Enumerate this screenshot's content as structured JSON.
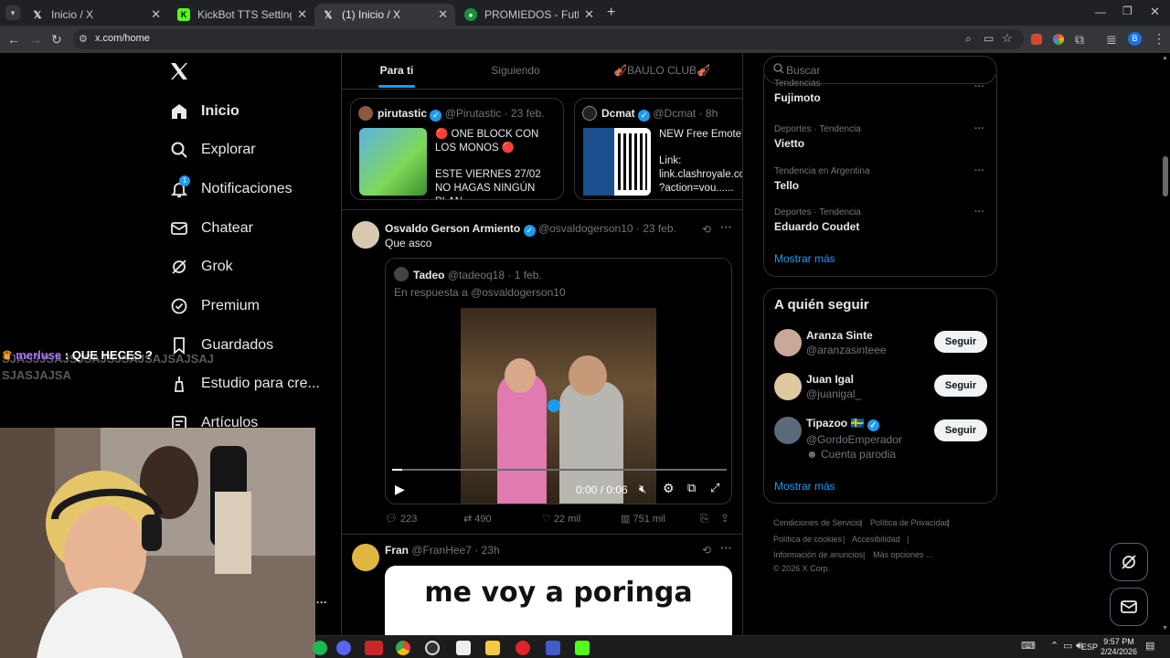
{
  "browser": {
    "tabs": [
      {
        "title": "Inicio / X",
        "active": false
      },
      {
        "title": "KickBot TTS Settings",
        "active": false
      },
      {
        "title": "(1) Inicio / X",
        "active": true
      },
      {
        "title": "PROMIEDOS - Futbol Argentino",
        "active": false
      }
    ],
    "url": "x.com/home"
  },
  "nav": {
    "items": [
      {
        "label": "Inicio",
        "icon": "home-icon"
      },
      {
        "label": "Explorar",
        "icon": "search-icon"
      },
      {
        "label": "Notificaciones",
        "icon": "bell-icon",
        "badge": "1"
      },
      {
        "label": "Chatear",
        "icon": "mail-icon"
      },
      {
        "label": "Grok",
        "icon": "grok-icon"
      },
      {
        "label": "Premium",
        "icon": "premium-icon"
      },
      {
        "label": "Guardados",
        "icon": "bookmark-icon"
      },
      {
        "label": "Estudio para cre...",
        "icon": "creator-studio-icon"
      },
      {
        "label": "Artículos",
        "icon": "articles-icon"
      }
    ]
  },
  "overlay_chat": {
    "username": "merluse",
    "message": ": QUE HECES ?",
    "ghost_line1": "SJASJJSAJSJSAJSJSAJSAJSAJSAJ",
    "ghost_line2": "SJASJAJSA"
  },
  "feed": {
    "tabs": [
      {
        "label": "Para ti",
        "active": true
      },
      {
        "label": "Siguiendo",
        "active": false
      },
      {
        "label": "🎻BAULO CLUB🎻",
        "active": false
      }
    ],
    "carousel": [
      {
        "name": "pirutastic",
        "handle": "@Pirutastic",
        "date": "23 feb.",
        "text1": "🔴 ONE BLOCK CON LOS MONOS 🔴",
        "text2": "ESTE VIERNES 27/02 NO HAGAS NINGÚN PLAN...."
      },
      {
        "name": "Dcmat",
        "handle": "@Dcmat",
        "date": "8h",
        "text1": "NEW Free Emote 😱",
        "text2": "Link: link.clashroyale.com ?action=vou......"
      }
    ],
    "post1": {
      "name": "Osvaldo Gerson Armiento",
      "handle": "@osvaldogerson10",
      "date": "23 feb.",
      "text": "Que asco",
      "quote": {
        "name": "Tadeo",
        "handle": "@tadeoq18",
        "date": "1 feb.",
        "reply_to": "En respuesta a @osvaldogerson10",
        "video_time": "0:00 / 0:06",
        "video_progress": 0.03
      },
      "stats": {
        "replies": "223",
        "reposts": "490",
        "likes": "22 mil",
        "views": "751 mil"
      }
    },
    "post2": {
      "name": "Fran",
      "handle": "@FranHee7",
      "date": "23h",
      "image_text": "me voy a poringa"
    }
  },
  "sidebar": {
    "search_placeholder": "Buscar",
    "trends_partial_cat": "Tendencias",
    "trends": [
      {
        "category": "",
        "name": "Fujimoto"
      },
      {
        "category": "Deportes · Tendencia",
        "name": "Vietto"
      },
      {
        "category": "Tendencia en Argentina",
        "name": "Tello"
      },
      {
        "category": "Deportes · Tendencia",
        "name": "Eduardo Coudet"
      }
    ],
    "show_more": "Mostrar más",
    "who_to_follow_title": "A quién seguir",
    "follow": [
      {
        "name": "Aranza Sinte",
        "handle": "@aranzasinteee",
        "extra": ""
      },
      {
        "name": "Juan Igal",
        "handle": "@juanigal_",
        "extra": ""
      },
      {
        "name": "Tipazoo 🇸🇪",
        "handle": "@GordoEmperador",
        "extra": "Cuenta parodia"
      }
    ],
    "follow_button": "Seguir",
    "footer": {
      "line1": [
        "Condiciones de Servicio",
        "Política de Privacidad"
      ],
      "line2": [
        "Política de cookies",
        "Accesibilidad"
      ],
      "line3": [
        "Información de anuncios",
        "Más opciones ..."
      ],
      "copyright": "© 2026 X Corp."
    }
  },
  "taskbar": {
    "time": "9:57 PM",
    "date": "2/24/2026",
    "lang": "ESP"
  },
  "colors": {
    "accent": "#1d9bf0",
    "background": "#000000",
    "border": "#2f3336"
  }
}
